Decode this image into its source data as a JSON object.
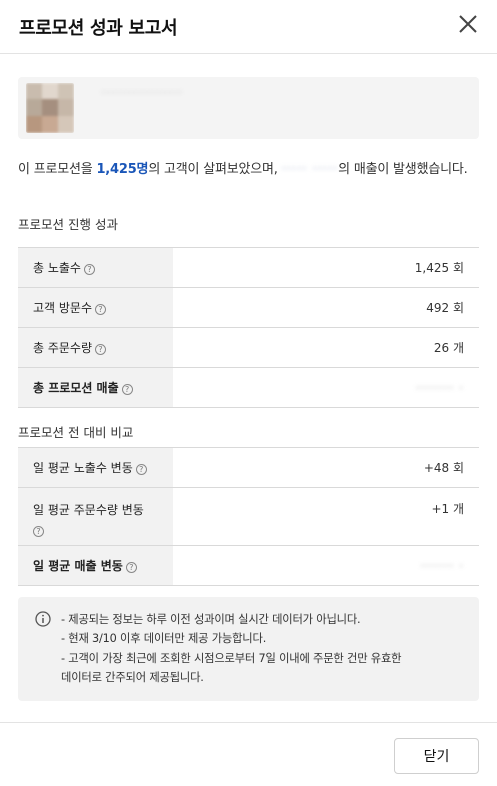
{
  "header": {
    "title": "프로모션 성과 보고서"
  },
  "product": {
    "name_blurred": "················"
  },
  "summary": {
    "prefix": "이 프로모션을 ",
    "visitors": "1,425명",
    "middle": "의 고객이 살펴보았으며, ",
    "sales_blurred": "·····  ·····",
    "suffix": "의 매출이 발생했습니다."
  },
  "performance": {
    "title": "프로모션 진행 성과",
    "rows": [
      {
        "label": "총 노출수",
        "value": "1,425 회"
      },
      {
        "label": "고객 방문수",
        "value": "492 회"
      },
      {
        "label": "총 주문수량",
        "value": "26 개"
      },
      {
        "label": "총 프로모션 매출",
        "value": "········  ·"
      }
    ]
  },
  "comparison": {
    "title": "프로모션 전 대비 비교",
    "rows": [
      {
        "label": "일 평균 노출수 변동",
        "value": "+48 회"
      },
      {
        "label": "일 평균 주문수량 변동",
        "value": "+1 개"
      },
      {
        "label": "일 평균 매출 변동",
        "value": "·······  ·"
      }
    ]
  },
  "notice": {
    "lines": [
      "- 제공되는 정보는 하루 이전 성과이며 실시간 데이터가 아닙니다.",
      "- 현재 3/10 이후 데이터만 제공 가능합니다.",
      "- 고객이 가장 최근에 조회한 시점으로부터 7일 이내에 주문한 건만 유효한",
      "데이터로 간주되어 제공됩니다."
    ]
  },
  "footer": {
    "close_label": "닫기"
  },
  "colors": {
    "accent": "#1a56b8",
    "label_bg": "#f2f2f2",
    "notice_bg": "#f2f2f2"
  },
  "icons": {
    "close": "close-icon",
    "help": "question-circle-icon",
    "info": "info-circle-icon"
  }
}
